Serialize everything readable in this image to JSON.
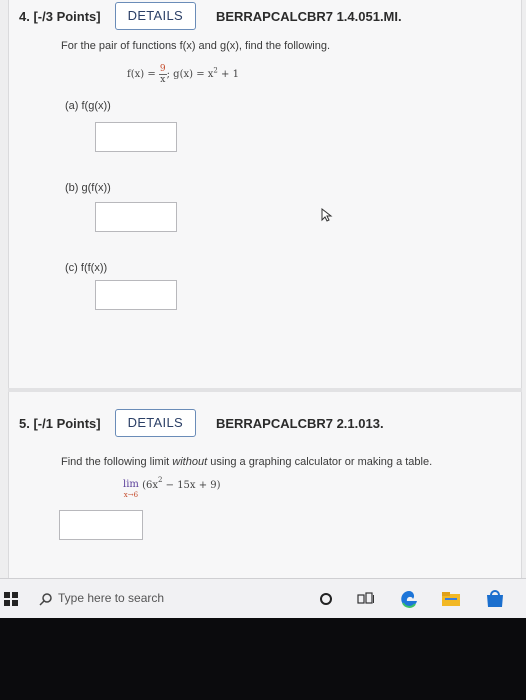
{
  "q4": {
    "number": "4. [-/3 Points]",
    "details_label": "DETAILS",
    "code": "BERRAPCALCBR7 1.4.051.MI.",
    "prompt": "For the pair of functions f(x) and g(x), find the following.",
    "func_f_lhs": "f(x) = ",
    "func_f_num": "9",
    "func_f_den": "x",
    "func_g": "; g(x) = x",
    "func_g_exp": "2",
    "func_g_tail": " + 1",
    "parts": [
      {
        "label": "(a)  f(g(x))"
      },
      {
        "label": "(b)  g(f(x))"
      },
      {
        "label": "(c)  f(f(x))"
      }
    ]
  },
  "q5": {
    "number": "5. [-/1 Points]",
    "details_label": "DETAILS",
    "code": "BERRAPCALCBR7 2.1.013.",
    "prompt_pre": "Find the following limit ",
    "prompt_em": "without",
    "prompt_post": " using a graphing calculator or making a table.",
    "lim_word": "lim",
    "lim_sub": "x→6",
    "expr_a": "(6x",
    "expr_exp": "2",
    "expr_b": " − 15x + 9)"
  },
  "taskbar": {
    "search_placeholder": "Type here to search",
    "icons": [
      "windows-icon",
      "search-icon",
      "cortana-icon",
      "task-view-icon",
      "edge-icon",
      "file-explorer-icon",
      "store-icon"
    ]
  },
  "colors": {
    "panel": "#f7f7f8",
    "button_border": "#6a8cb8",
    "edge_blue": "#1d75d8",
    "accent_red": "#c44a2a"
  }
}
